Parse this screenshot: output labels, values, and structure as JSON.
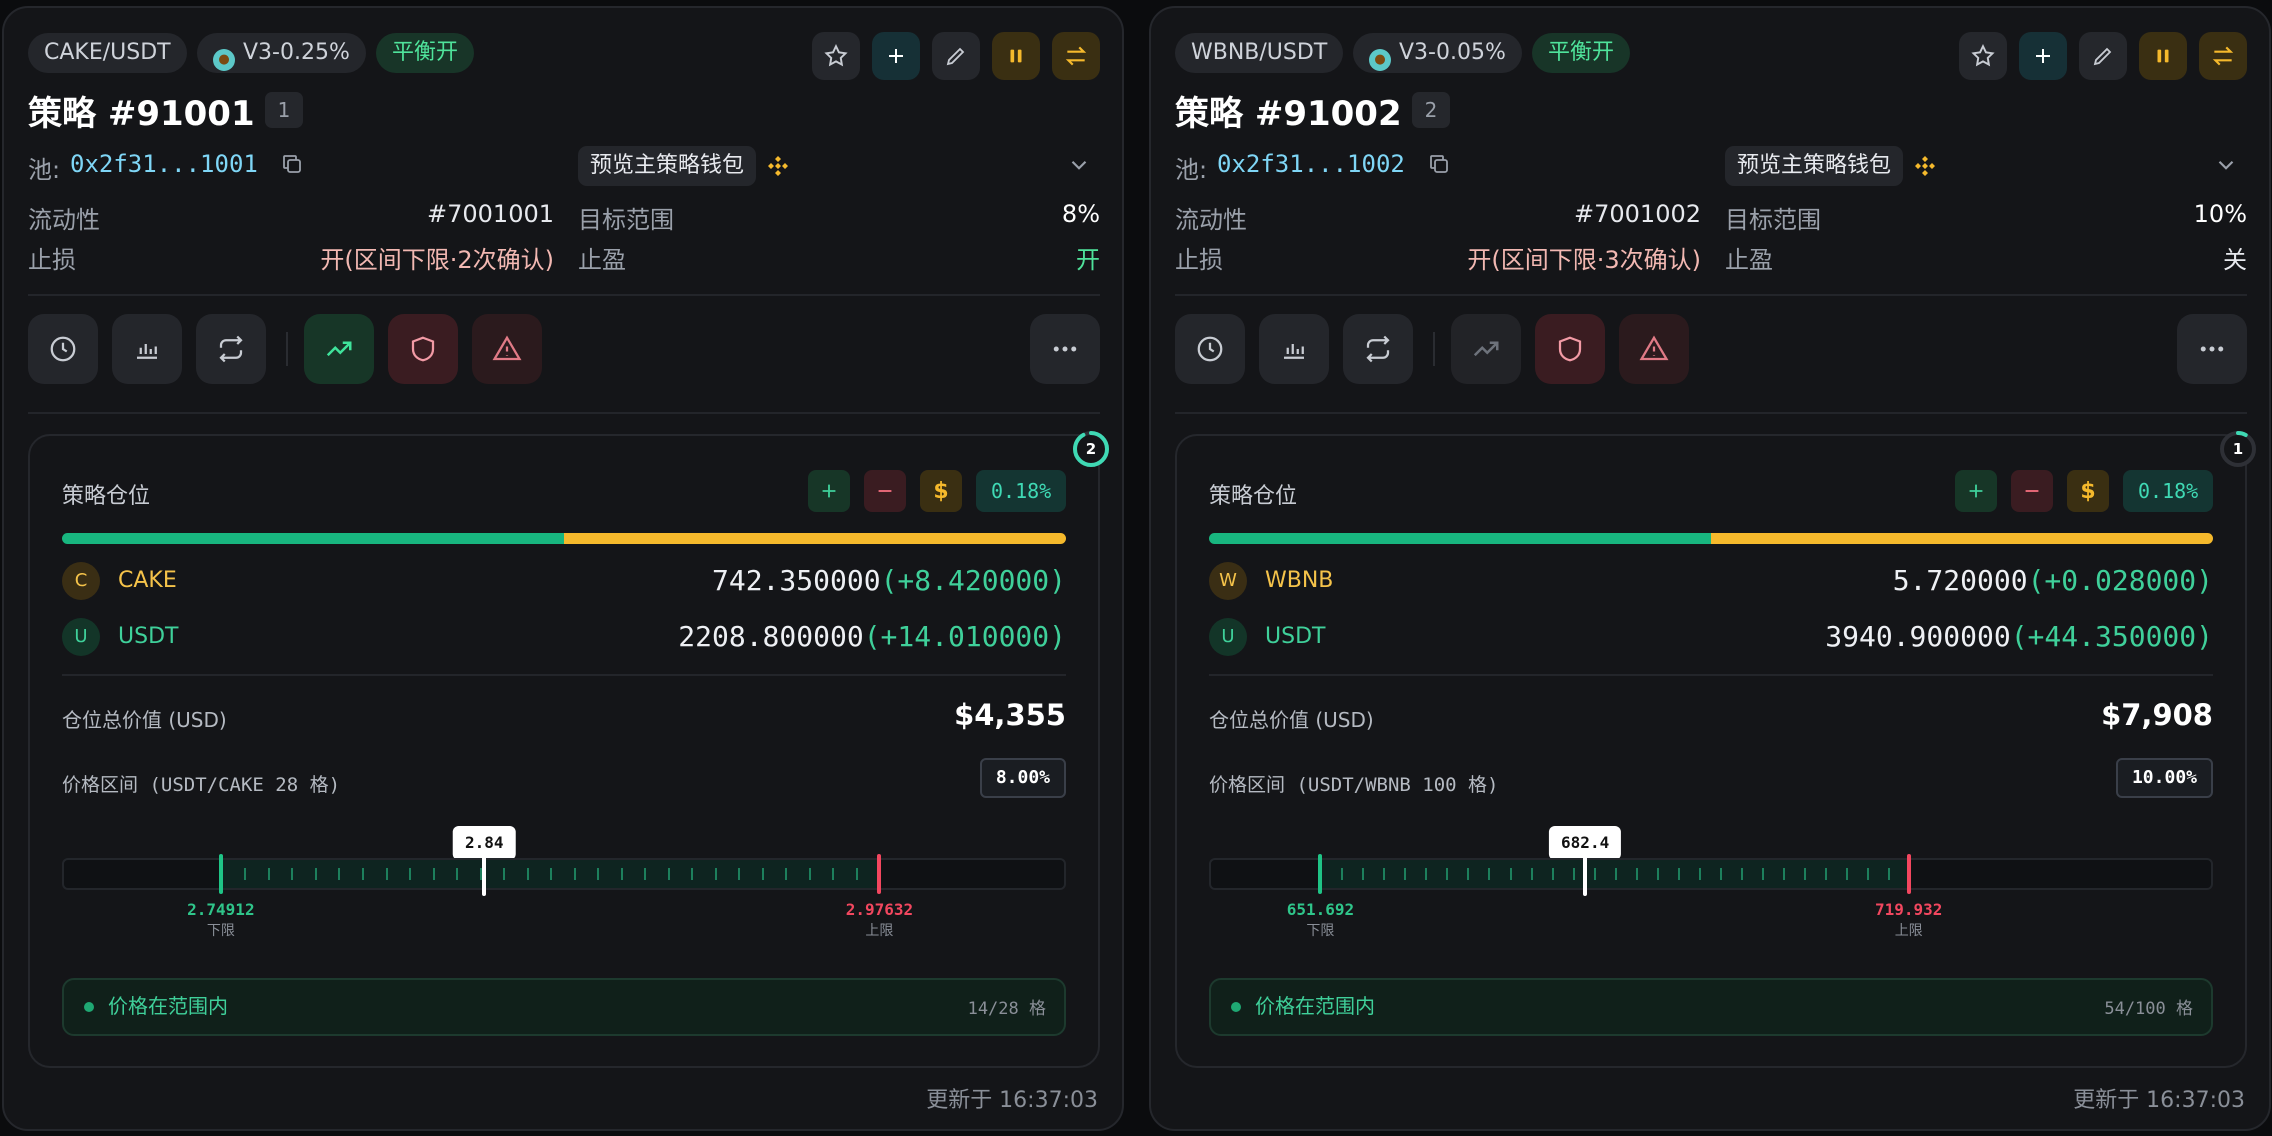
{
  "cards": [
    {
      "pair": "CAKE/USDT",
      "fee_tier": "V3-0.25%",
      "rebalance_badge": "平衡开",
      "title": "策略 #91001",
      "index": "1",
      "pool_label": "池:",
      "pool_address": "0x2f31...1001",
      "wallet_button": "预览主策略钱包",
      "liquidity_label": "流动性",
      "liquidity_value": "#7001001",
      "target_range_label": "目标范围",
      "target_range_value": "8%",
      "stop_loss_label": "止损",
      "stop_loss_value": "开(区间下限·2次确认)",
      "take_profit_label": "止盈",
      "take_profit_value": "开",
      "take_profit_color": "#4fe39b",
      "ring_count": "2",
      "position_title": "策略仓位",
      "position_pct": "0.18%",
      "allocation_base_fraction": 0.5,
      "tokens": [
        {
          "icon": "C",
          "name": "CAKE",
          "amount": "742.350000",
          "delta": "(+8.420000)",
          "color": "#f5c34a"
        },
        {
          "icon": "U",
          "name": "USDT",
          "amount": "2208.800000",
          "delta": "(+14.010000)",
          "color": "#3fd09a"
        }
      ],
      "total_label": "仓位总价值 (USD)",
      "total_value": "$4,355",
      "range_label": "价格区间 (USDT/CAKE 28 格)",
      "range_pct": "8.00%",
      "grid_count": 28,
      "axis_min": 2.695,
      "axis_max": 3.04,
      "lower": 2.74912,
      "upper": 2.97632,
      "current": 2.84,
      "current_label": "2.84",
      "lower_label": "2.74912",
      "upper_label": "2.97632",
      "lower_sub": "下限",
      "upper_sub": "上限",
      "status_text": "价格在范围内",
      "grid_status": "14/28 格",
      "updated": "更新于 16:37:03"
    },
    {
      "pair": "WBNB/USDT",
      "fee_tier": "V3-0.05%",
      "rebalance_badge": "平衡开",
      "title": "策略 #91002",
      "index": "2",
      "pool_label": "池:",
      "pool_address": "0x2f31...1002",
      "wallet_button": "预览主策略钱包",
      "liquidity_label": "流动性",
      "liquidity_value": "#7001002",
      "target_range_label": "目标范围",
      "target_range_value": "10%",
      "stop_loss_label": "止损",
      "stop_loss_value": "开(区间下限·3次确认)",
      "take_profit_label": "止盈",
      "take_profit_value": "关",
      "take_profit_color": "#e7e9ee",
      "ring_count": "1",
      "position_title": "策略仓位",
      "position_pct": "0.18%",
      "allocation_base_fraction": 0.5,
      "tokens": [
        {
          "icon": "W",
          "name": "WBNB",
          "amount": "5.720000",
          "delta": "(+0.028000)",
          "color": "#f5c34a"
        },
        {
          "icon": "U",
          "name": "USDT",
          "amount": "3940.900000",
          "delta": "(+44.350000)",
          "color": "#3fd09a"
        }
      ],
      "total_label": "仓位总价值 (USD)",
      "total_value": "$7,908",
      "range_label": "价格区间 (USDT/WBNB 100 格)",
      "range_pct": "10.00%",
      "grid_count": 28,
      "axis_min": 639.0,
      "axis_max": 755.0,
      "lower": 651.692,
      "upper": 719.932,
      "current": 682.4,
      "current_label": "682.4",
      "lower_label": "651.692",
      "upper_label": "719.932",
      "lower_sub": "下限",
      "upper_sub": "上限",
      "status_text": "价格在范围内",
      "grid_status": "54/100 格",
      "updated": "更新于 16:37:03"
    }
  ],
  "icons": {
    "star": "star-icon",
    "plus": "plus-icon",
    "edit": "pencil-icon",
    "pause": "pause-icon",
    "swap": "swap-icon",
    "copy": "copy-icon",
    "expand": "chevron-down-icon",
    "clock": "clock-icon",
    "chart": "bar-chart-icon",
    "cycle": "repeat-icon",
    "trend": "trending-up-icon",
    "shield": "shield-icon",
    "alert": "alert-triangle-icon",
    "more": "more-horizontal-icon",
    "dollar": "dollar-icon",
    "minus": "minus-icon"
  }
}
